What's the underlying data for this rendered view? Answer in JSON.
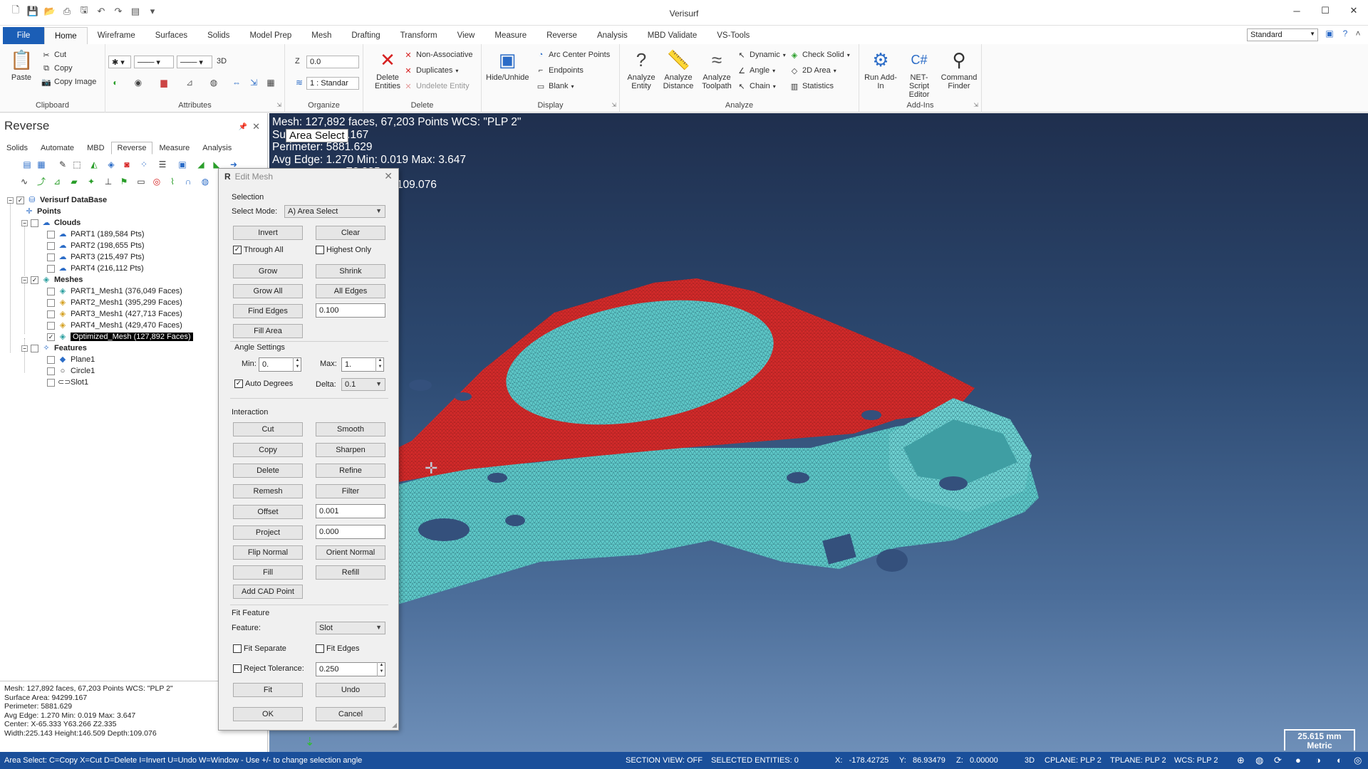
{
  "app": {
    "title": "Verisurf"
  },
  "ribbon_tabs": [
    "File",
    "Home",
    "Wireframe",
    "Surfaces",
    "Solids",
    "Model Prep",
    "Mesh",
    "Drafting",
    "Transform",
    "View",
    "Measure",
    "Reverse",
    "Analysis",
    "MBD Validate",
    "VS-Tools"
  ],
  "workspace": "Standard",
  "ribbon": {
    "clipboard": {
      "label": "Clipboard",
      "paste": "Paste",
      "cut": "Cut",
      "copy": "Copy",
      "copy_image": "Copy Image"
    },
    "attributes": {
      "label": "Attributes",
      "mode_3d": "3D"
    },
    "organize": {
      "label": "Organize",
      "z_label": "Z",
      "z_value": "0.0",
      "level": "1 : Standar"
    },
    "delete": {
      "label": "Delete",
      "delete_entities": "Delete Entities",
      "non_associative": "Non-Associative",
      "duplicates": "Duplicates",
      "undelete": "Undelete Entity"
    },
    "display": {
      "label": "Display",
      "hide_unhide": "Hide/Unhide",
      "arc_center": "Arc Center Points",
      "endpoints": "Endpoints",
      "blank": "Blank"
    },
    "analyze": {
      "label": "Analyze",
      "entity": "Analyze Entity",
      "distance": "Analyze Distance",
      "toolpath": "Analyze Toolpath",
      "dynamic": "Dynamic",
      "angle": "Angle",
      "chain": "Chain",
      "check_solid": "Check Solid",
      "area_2d": "2D Area",
      "statistics": "Statistics"
    },
    "addins": {
      "label": "Add-Ins",
      "run": "Run Add-In",
      "net_script": "NET-Script Editor",
      "command_finder": "Command Finder"
    }
  },
  "left_panel": {
    "title": "Reverse",
    "tabs": [
      "Solids",
      "Automate",
      "MBD",
      "Reverse",
      "Measure",
      "Analysis"
    ],
    "tree": {
      "root": "Verisurf DataBase",
      "points": "Points",
      "clouds": "Clouds",
      "cloud_items": [
        "PART1 (189,584 Pts)",
        "PART2 (198,655 Pts)",
        "PART3 (215,497 Pts)",
        "PART4 (216,112 Pts)"
      ],
      "meshes": "Meshes",
      "mesh_items": [
        "PART1_Mesh1 (376,049 Faces)",
        "PART2_Mesh1 (395,299 Faces)",
        "PART3_Mesh1 (427,713 Faces)",
        "PART4_Mesh1 (429,470 Faces)",
        "Optimized_Mesh (127,892 Faces)"
      ],
      "features": "Features",
      "feature_items": [
        "Plane1",
        "Circle1",
        "Slot1"
      ]
    },
    "info": [
      "Mesh: 127,892 faces, 67,203 Points  WCS: \"PLP 2\"",
      "Surface Area: 94299.167",
      "Perimeter: 5881.629",
      "Avg Edge: 1.270 Min: 0.019 Max: 3.647",
      "Center: X-65.333 Y63.266 Z2.335",
      "Width:225.143 Height:146.509 Depth:109.076"
    ]
  },
  "viewport": {
    "info": [
      "Mesh: 127,892 faces, 67,203 Points  WCS: \"PLP 2\"",
      "Su          94299.167",
      "Perimeter: 5881.629",
      "Avg Edge: 1.270 Min: 0.019 Max: 3.647",
      "                        Z2.335",
      "                    6.509 Depth:109.076"
    ],
    "tooltip": "Area Select",
    "scale_value": "25.615 mm",
    "scale_unit": "Metric"
  },
  "dialog": {
    "title": "Edit Mesh",
    "selection": {
      "label": "Selection",
      "select_mode_label": "Select Mode:",
      "select_mode": "A) Area Select",
      "invert": "Invert",
      "clear": "Clear",
      "through_all": "Through All",
      "highest_only": "Highest Only",
      "grow": "Grow",
      "shrink": "Shrink",
      "grow_all": "Grow All",
      "all_edges": "All Edges",
      "find_edges": "Find Edges",
      "find_edges_value": "0.100",
      "fill_area": "Fill Area"
    },
    "angle": {
      "label": "Angle Settings",
      "min_label": "Min:",
      "min": "0.",
      "max_label": "Max:",
      "max": "1.",
      "auto_degrees": "Auto Degrees",
      "delta_label": "Delta:",
      "delta": "0.1"
    },
    "interaction": {
      "label": "Interaction",
      "cut": "Cut",
      "smooth": "Smooth",
      "copy": "Copy",
      "sharpen": "Sharpen",
      "delete": "Delete",
      "refine": "Refine",
      "remesh": "Remesh",
      "filter": "Filter",
      "offset": "Offset",
      "offset_value": "0.001",
      "project": "Project",
      "project_value": "0.000",
      "flip_normal": "Flip Normal",
      "orient_normal": "Orient Normal",
      "fill": "Fill",
      "refill": "Refill",
      "add_cad_point": "Add CAD Point"
    },
    "fit": {
      "label": "Fit Feature",
      "feature_label": "Feature:",
      "feature": "Slot",
      "fit_separate": "Fit Separate",
      "fit_edges": "Fit Edges",
      "reject_tolerance": "Reject Tolerance:",
      "reject_value": "0.250",
      "fit": "Fit",
      "undo": "Undo"
    },
    "ok": "OK",
    "cancel": "Cancel"
  },
  "statusbar": {
    "hint": "Area Select: C=Copy X=Cut D=Delete I=Invert U=Undo W=Window - Use +/- to change selection angle",
    "section_view": "SECTION VIEW: OFF",
    "selected": "SELECTED ENTITIES: 0",
    "x": "X:   -178.42725",
    "y": "Y:   86.93479",
    "z": "Z:   0.00000",
    "mode": "3D",
    "cplane": "CPLANE: PLP 2",
    "tplane": "TPLANE: PLP 2",
    "wcs": "WCS: PLP 2"
  },
  "colors": {
    "accent": "#1b5eb6",
    "status": "#1a4f9a",
    "mesh_cyan": "#5ec8c8",
    "mesh_selected": "#d42a2a"
  }
}
